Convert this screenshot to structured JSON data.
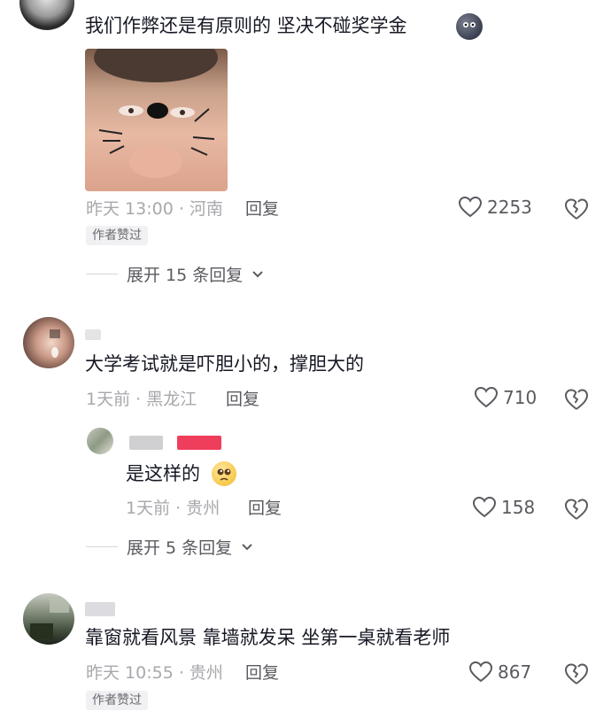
{
  "comments": [
    {
      "text": "我们作弊还是有原则的 坚决不碰奖学金",
      "time_location": "昨天 13:00 · 河南",
      "reply_label": "回复",
      "likes": "2253",
      "author_liked": "作者赞过",
      "expand_label": "展开 15 条回复"
    },
    {
      "text": "大学考试就是吓胆小的，撑胆大的",
      "time_location": "1天前 · 黑龙江",
      "reply_label": "回复",
      "likes": "710",
      "replies": [
        {
          "text": "是这样的",
          "time_location": "1天前 · 贵州",
          "reply_label": "回复",
          "likes": "158"
        }
      ],
      "expand_label": "展开 5 条回复"
    },
    {
      "text": "靠窗就看风景 靠墙就发呆 坐第一桌就看老师",
      "time_location": "昨天 10:55 · 贵州",
      "reply_label": "回复",
      "likes": "867",
      "author_liked": "作者赞过"
    }
  ],
  "icons": {
    "like": "heart-outline-icon",
    "dislike": "broken-heart-icon",
    "chevron": "chevron-down-icon"
  },
  "colors": {
    "text": "#161823",
    "meta": "#a8a8ad",
    "action": "#5a5a60",
    "badge_bg": "#f1f1f3"
  }
}
